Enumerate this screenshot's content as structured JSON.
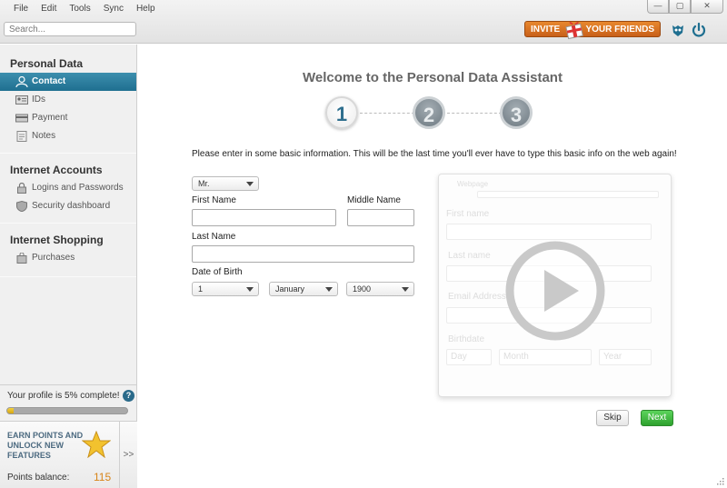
{
  "menu": [
    "File",
    "Edit",
    "Tools",
    "Sync",
    "Help"
  ],
  "search": {
    "placeholder": "Search..."
  },
  "window_controls": {
    "minimize": "—",
    "maximize": "▢",
    "close": "✕"
  },
  "invite": {
    "left": "INVITE",
    "right": "YOUR FRIENDS"
  },
  "sidebar": {
    "sections": [
      {
        "title": "Personal Data",
        "items": [
          {
            "label": "Contact",
            "icon": "person-icon",
            "active": true
          },
          {
            "label": "IDs",
            "icon": "id-card-icon"
          },
          {
            "label": "Payment",
            "icon": "credit-card-icon"
          },
          {
            "label": "Notes",
            "icon": "notes-icon"
          }
        ]
      },
      {
        "title": "Internet Accounts",
        "items": [
          {
            "label": "Logins and Passwords",
            "icon": "lock-icon"
          },
          {
            "label": "Security dashboard",
            "icon": "shield-icon"
          }
        ]
      },
      {
        "title": "Internet Shopping",
        "items": [
          {
            "label": "Purchases",
            "icon": "shopping-bag-icon"
          }
        ]
      }
    ],
    "profile": {
      "text": "Your profile is 5% complete!",
      "help": "?",
      "progress": 0.05
    },
    "earn": {
      "text": "EARN POINTS AND UNLOCK NEW FEATURES",
      "expand": ">>",
      "balance_label": "Points balance:",
      "balance_value": "115"
    }
  },
  "main": {
    "title": "Welcome to the Personal Data Assistant",
    "steps": [
      "1",
      "2",
      "3"
    ],
    "active_step": 1,
    "intro": "Please enter in some basic information. This will be the last time you'll ever have to type this basic info on the web again!",
    "form": {
      "salutation": "Mr.",
      "first_name_label": "First Name",
      "middle_name_label": "Middle Name",
      "last_name_label": "Last Name",
      "dob_label": "Date of Birth",
      "day": "1",
      "month": "January",
      "year": "1900"
    },
    "video_preview": {
      "tab": "Webpage",
      "fields": [
        "First name",
        "Last name",
        "Email Address",
        "Birthdate"
      ],
      "day": "Day",
      "month": "Month",
      "year": "Year"
    },
    "skip_label": "Skip",
    "next_label": "Next"
  },
  "colors": {
    "accent": "#2a7a9c",
    "invite": "#d9701f",
    "next": "#3cb43c",
    "points": "#d88418"
  }
}
